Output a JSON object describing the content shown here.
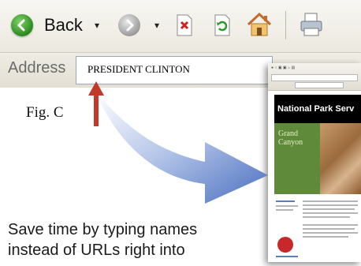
{
  "toolbar": {
    "back_label": "Back",
    "dropdown_glyph": "▾",
    "icons": [
      "back-arrow-icon",
      "forward-arrow-icon",
      "stop-icon",
      "refresh-icon",
      "home-icon",
      "print-icon"
    ]
  },
  "address": {
    "label": "Address",
    "value": "PRESIDENT CLINTON"
  },
  "annotation": {
    "fig_label": "Fig. C",
    "arrow_color": "#c0392b"
  },
  "caption": {
    "line1": "Save time by typing names",
    "line2": "instead of URLs right into"
  },
  "thumbnail": {
    "header": "National Park Serv",
    "park": "Grand Canyon"
  },
  "colors": {
    "accent_red": "#c0392b",
    "park_green": "#5f8a3a",
    "curve_blue": "#5b7fc4"
  }
}
